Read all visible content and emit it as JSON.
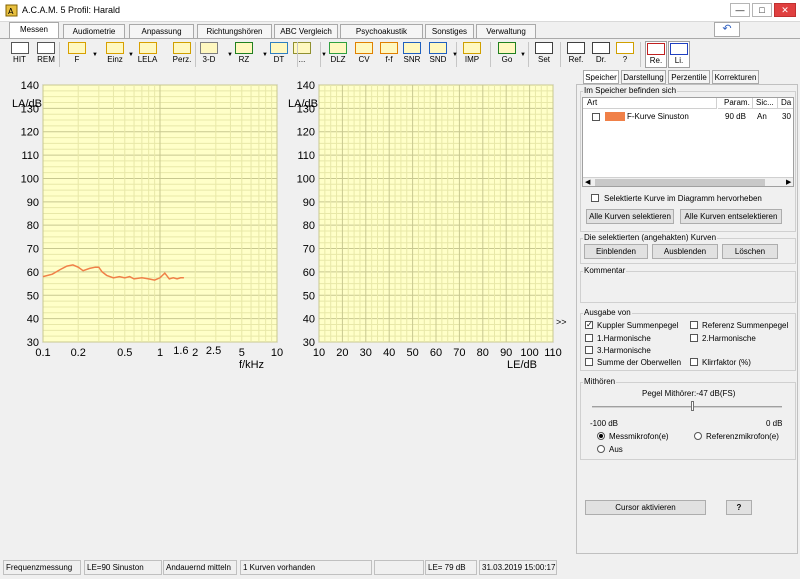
{
  "app": {
    "title": "A.C.A.M. 5  Profil: Harald"
  },
  "window_controls": {
    "minimize": "—",
    "maximize": "□",
    "close": "✕",
    "undo": "↶"
  },
  "tabs": [
    {
      "label": "Messen"
    },
    {
      "label": "Audiometrie"
    },
    {
      "label": "Anpassung"
    },
    {
      "label": "Richtungshören"
    },
    {
      "label": "ABC Vergleich"
    },
    {
      "label": "Psychoakustik"
    },
    {
      "label": "Sonstiges"
    },
    {
      "label": "Verwaltung"
    }
  ],
  "toolbar": [
    {
      "label": "HIT",
      "icon": "hit-icon"
    },
    {
      "label": "REM",
      "icon": "rem-icon"
    },
    {
      "label": "F",
      "icon": "curve-f-icon"
    },
    {
      "label": "Einz",
      "icon": "single-icon"
    },
    {
      "label": "LELA",
      "icon": "lela-icon"
    },
    {
      "label": "Perz.",
      "icon": "perz-icon"
    },
    {
      "label": "3-D",
      "icon": "3d-icon"
    },
    {
      "label": "RZ",
      "icon": "rz-icon"
    },
    {
      "label": "DT",
      "icon": "dt-icon"
    },
    {
      "label": "...",
      "icon": "more-icon"
    },
    {
      "label": "DLZ",
      "icon": "dlz-icon"
    },
    {
      "label": "CV",
      "icon": "cv-icon"
    },
    {
      "label": "f-f",
      "icon": "ff-icon"
    },
    {
      "label": "SNR",
      "icon": "snr-icon"
    },
    {
      "label": "SND",
      "icon": "snd-icon"
    },
    {
      "label": "IMP",
      "icon": "imp-icon"
    },
    {
      "label": "Go",
      "icon": "go-icon"
    },
    {
      "label": "Set",
      "icon": "tools-icon"
    },
    {
      "label": "Ref.",
      "icon": "glasses-icon"
    },
    {
      "label": "Dr.",
      "icon": "printer-icon"
    },
    {
      "label": "?",
      "icon": "help-icon"
    },
    {
      "label": "Re.",
      "icon": "ear-red-icon"
    },
    {
      "label": "Li.",
      "icon": "ear-blue-icon"
    }
  ],
  "chart_data": [
    {
      "type": "line",
      "ylabel": "LA/dB",
      "xlabel": "f/kHz",
      "xscale": "log",
      "xlim": [
        0.1,
        10
      ],
      "ylim": [
        30,
        140
      ],
      "yticks": [
        30,
        40,
        50,
        60,
        70,
        80,
        90,
        100,
        110,
        120,
        130,
        140
      ],
      "xtick_labels": [
        "0.1",
        "0.2",
        "0.5",
        "1",
        "1.6",
        "2",
        "2.5",
        "5",
        "10"
      ],
      "grid": true,
      "series": [
        {
          "color": "#f08048",
          "x": [
            0.1,
            0.12,
            0.14,
            0.16,
            0.18,
            0.2,
            0.22,
            0.25,
            0.28,
            0.3,
            0.32,
            0.35,
            0.4,
            0.45,
            0.5,
            0.55,
            0.6,
            0.7,
            0.8,
            0.9,
            1.0,
            1.1,
            1.2,
            1.3,
            1.4,
            1.5,
            1.6
          ],
          "y": [
            58,
            59,
            61,
            62.5,
            63,
            62,
            60.5,
            61.5,
            62,
            62,
            60,
            58.5,
            57.5,
            58,
            57.5,
            58,
            57,
            57.5,
            57,
            56.5,
            57.5,
            59.5,
            57,
            57.5,
            57,
            57.5,
            57.5
          ]
        }
      ]
    },
    {
      "type": "line",
      "ylabel": "LA/dB",
      "xlabel": "LE/dB",
      "xlim": [
        10,
        110
      ],
      "ylim": [
        30,
        140
      ],
      "yticks": [
        30,
        40,
        50,
        60,
        70,
        80,
        90,
        100,
        110,
        120,
        130,
        140
      ],
      "xticks": [
        10,
        20,
        30,
        40,
        50,
        60,
        70,
        80,
        90,
        100,
        110
      ],
      "grid": true,
      "series": []
    }
  ],
  "collapse_arrow": ">>",
  "right_panel": {
    "tabs": [
      "Speicher",
      "Darstellung",
      "Perzentile",
      "Korrekturen"
    ],
    "memory_group": "Im Speicher befinden sich",
    "table_headers": [
      "Art",
      "Param.",
      "Sic...",
      "Da"
    ],
    "rows": [
      {
        "name": "F-Kurve Sinuston",
        "param": "90 dB",
        "sic": "An",
        "da": "30",
        "color": "#f08048"
      }
    ],
    "highlight_checkbox": "Selektierte Kurve im Diagramm hervorheben",
    "select_all": "Alle Kurven selektieren",
    "deselect_all": "Alle Kurven entselektieren",
    "selected_group": "Die selektierten (angehakten) Kurven",
    "show": "Einblenden",
    "hide": "Ausblenden",
    "delete": "Löschen",
    "comment_group": "Kommentar",
    "output_group": "Ausgabe von",
    "output_options": [
      {
        "label": "Kuppler Summenpegel",
        "checked": true
      },
      {
        "label": "Referenz Summenpegel",
        "checked": false
      },
      {
        "label": "1.Harmonische",
        "checked": false
      },
      {
        "label": "2.Harmonische",
        "checked": false
      },
      {
        "label": "3.Harmonische",
        "checked": false
      },
      {
        "label": "Summe der Oberwellen",
        "checked": false
      },
      {
        "label": "Klirrfaktor (%)",
        "checked": false
      }
    ],
    "monitor_group": "Mithören",
    "level_label": "Pegel  Mithörer:-47 dB(FS)",
    "slider_min": "-100 dB",
    "slider_max": "0 dB",
    "slider_level_db": -47,
    "radio_options": [
      {
        "label": "Messmikrofon(e)",
        "selected": true
      },
      {
        "label": "Referenzmikrofon(e)",
        "selected": false
      },
      {
        "label": "Aus",
        "selected": false
      }
    ],
    "cursor_button": "Cursor aktivieren",
    "help_button": "?"
  },
  "status": [
    "Frequenzmessung",
    "LE=90 Sinuston",
    "Andauernd mitteln",
    "1 Kurven vorhanden",
    "",
    "LE= 79 dB",
    "31.03.2019 15:00:17"
  ]
}
